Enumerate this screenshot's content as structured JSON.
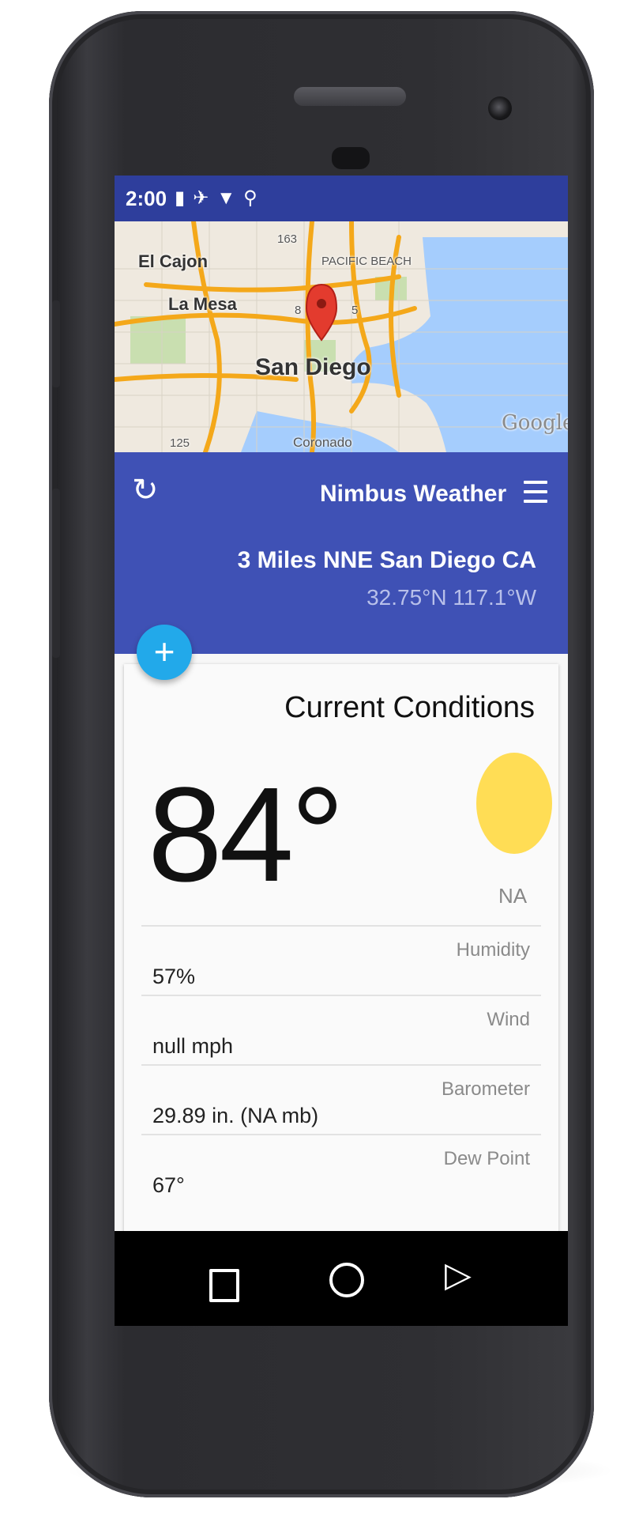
{
  "status_bar": {
    "time": "2:00",
    "icons": [
      "battery-icon",
      "airplane-icon",
      "wifi-icon",
      "location-icon"
    ]
  },
  "map": {
    "labels": {
      "el_cajon": "El Cajon",
      "la_mesa": "La Mesa",
      "san_diego": "San Diego",
      "pacific_beach": "PACIFIC BEACH",
      "coronado": "Coronado",
      "google": "Google",
      "shield_163": "163",
      "shield_8": "8",
      "shield_5": "5",
      "shield_125": "125"
    }
  },
  "app_bar": {
    "title": "Nimbus Weather",
    "location_name": "3 Miles NNE San Diego CA",
    "location_coords": "32.75°N 117.1°W",
    "fab_label": "+"
  },
  "current_conditions": {
    "title": "Current Conditions",
    "temperature": "84°",
    "condition": "NA",
    "rows": [
      {
        "label": "Humidity",
        "value": "57%"
      },
      {
        "label": "Wind",
        "value": "null mph"
      },
      {
        "label": "Barometer",
        "value": "29.89 in. (NA mb)"
      },
      {
        "label": "Dew Point",
        "value": "67°"
      }
    ]
  },
  "colors": {
    "status_bar": "#2e3e9c",
    "app_bar": "#3f51b5",
    "fab": "#22a9ea",
    "sun": "#ffdd55",
    "water": "#a5cdfd",
    "highway": "#f4a81a"
  }
}
